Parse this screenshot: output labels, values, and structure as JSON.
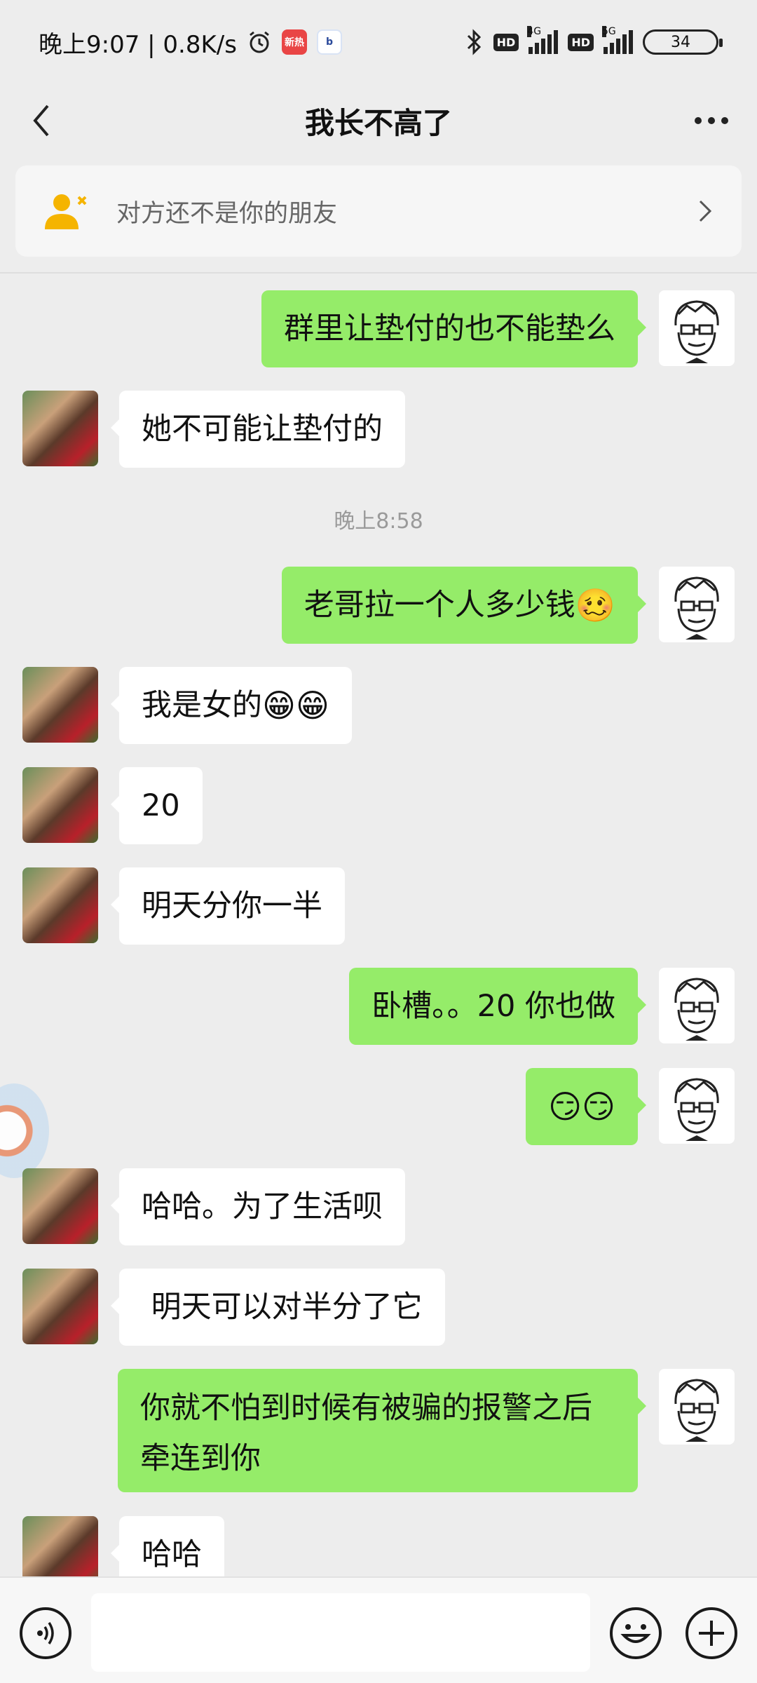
{
  "status_bar": {
    "time_speed": "晚上9:07 | 0.8K/s",
    "app_badge_1": "新热",
    "app_badge_2": "b",
    "hd_1": "HD",
    "net_1": "4G",
    "hd_2": "HD",
    "net_2": "5G",
    "battery": "34"
  },
  "header": {
    "title": "我长不高了"
  },
  "notice": {
    "text": "对方还不是你的朋友"
  },
  "messages": [
    {
      "from": "me",
      "text": "群里让垫付的也不能垫么"
    },
    {
      "from": "friend",
      "text": "她不可能让垫付的"
    },
    {
      "type": "timestamp",
      "text": "晚上8:58"
    },
    {
      "from": "me",
      "text": "老哥拉一个人多少钱",
      "emoji": "🥴"
    },
    {
      "from": "friend",
      "text": "我是女的",
      "emoji": "😁😁"
    },
    {
      "from": "friend",
      "text": "20"
    },
    {
      "from": "friend",
      "text": "明天分你一半"
    },
    {
      "from": "me",
      "text": "卧槽。。20 你也做"
    },
    {
      "from": "me",
      "text": "",
      "emoji": "😏😏"
    },
    {
      "from": "friend",
      "text": "哈哈。为了生活呗"
    },
    {
      "from": "friend",
      "text": " 明天可以对半分了它"
    },
    {
      "from": "me",
      "text": "你就不怕到时候有被骗的报警之后牵连到你"
    },
    {
      "from": "friend",
      "text": "哈哈"
    }
  ],
  "colors": {
    "background": "#ededed",
    "my_bubble": "#95ec69",
    "friend_bubble": "#ffffff",
    "notice_icon": "#f5b400"
  },
  "icons": {
    "back": "chevron-left-icon",
    "more": "more-dots-icon",
    "notice": "add-friend-icon",
    "notice_arrow": "chevron-right-icon",
    "voice": "voice-icon",
    "emoji": "emoji-icon",
    "plus": "plus-icon"
  }
}
